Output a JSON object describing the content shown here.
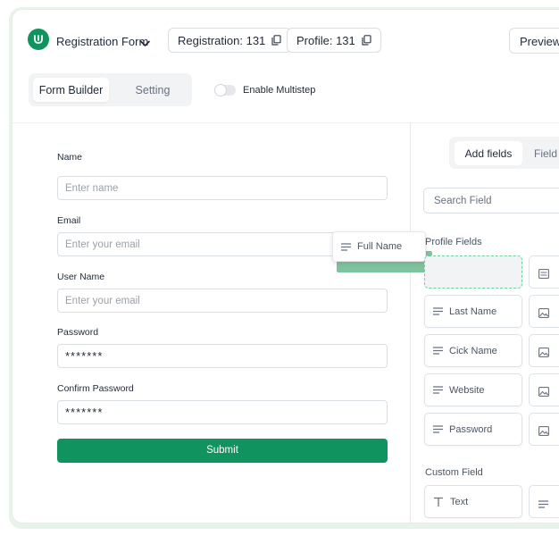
{
  "header": {
    "form_title": "Registration Form",
    "registration_badge": "Registration: 131",
    "profile_badge": "Profile: 131",
    "preview_label": "Preview"
  },
  "tabs": {
    "form_builder": "Form Builder",
    "setting": "Setting"
  },
  "multistep": {
    "label": "Enable Multistep",
    "enabled": false
  },
  "form": {
    "fields": [
      {
        "label": "Name",
        "placeholder": "Enter name"
      },
      {
        "label": "Email",
        "placeholder": "Enter your email"
      },
      {
        "label": "User Name",
        "placeholder": "Enter your email"
      },
      {
        "label": "Password",
        "value": "*******"
      },
      {
        "label": "Confirm Password",
        "value": "*******"
      }
    ],
    "submit_label": "Submit"
  },
  "dragging": {
    "label": "Full Name"
  },
  "panel": {
    "tabs": {
      "add_fields": "Add fields",
      "field_options": "Field o"
    },
    "search_placeholder": "Search Field",
    "profile_fields_title": "Profile Fields",
    "profile_fields": [
      "Last Name",
      "Cick Name",
      "Website",
      "Password"
    ],
    "custom_field_title": "Custom Field",
    "custom_fields": [
      "Text"
    ]
  },
  "colors": {
    "accent": "#10935f",
    "drop_border": "#6ccf9c",
    "frame_tint": "#e6f4ea"
  }
}
